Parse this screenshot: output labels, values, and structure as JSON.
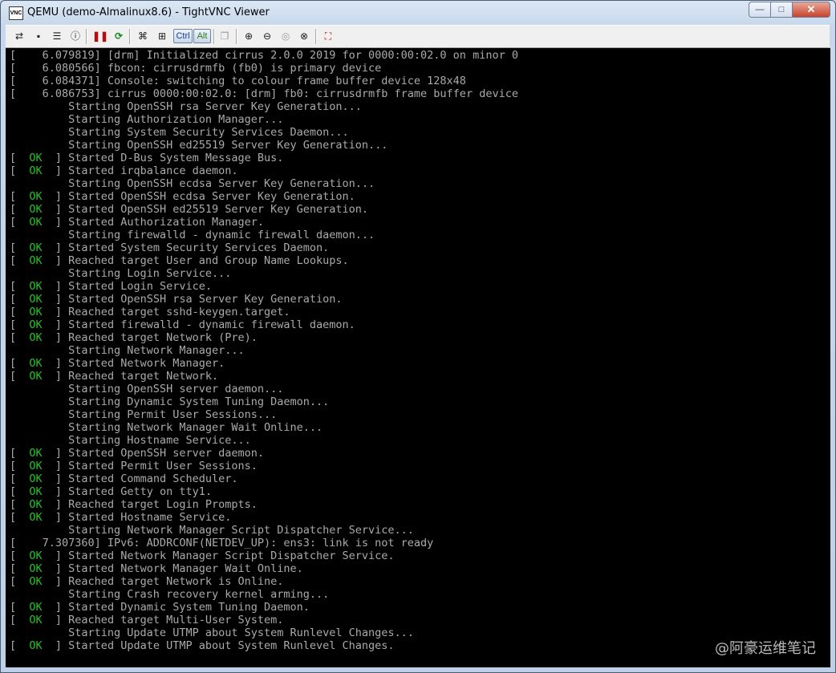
{
  "window": {
    "title": "QEMU (demo-Almalinux8.6) - TightVNC Viewer",
    "app_icon_text": "VNC",
    "controls": {
      "minimize": "—",
      "maximize": "□",
      "close": "✕"
    }
  },
  "toolbar": {
    "ctrl_label": "Ctrl",
    "alt_label": "Alt",
    "icons": [
      "new-connection-icon",
      "save-icon",
      "options-icon",
      "info-icon",
      "pause-icon",
      "refresh-icon",
      "ctrl-alt-del-icon",
      "ctrl-esc-icon",
      "ctrl-key-icon",
      "alt-key-icon",
      "clipboard-icon",
      "zoom-in-icon",
      "zoom-out-icon",
      "zoom-100-icon",
      "zoom-fit-icon",
      "fullscreen-icon"
    ]
  },
  "console": {
    "lines": [
      {
        "status": "",
        "text": "[    6.079819] [drm] Initialized cirrus 2.0.0 2019 for 0000:00:02.0 on minor 0"
      },
      {
        "status": "",
        "text": "[    6.080566] fbcon: cirrusdrmfb (fb0) is primary device"
      },
      {
        "status": "",
        "text": "[    6.084371] Console: switching to colour frame buffer device 128x48"
      },
      {
        "status": "",
        "text": "[    6.086753] cirrus 0000:00:02.0: [drm] fb0: cirrusdrmfb frame buffer device"
      },
      {
        "status": "",
        "text": "         Starting OpenSSH rsa Server Key Generation..."
      },
      {
        "status": "",
        "text": "         Starting Authorization Manager..."
      },
      {
        "status": "",
        "text": "         Starting System Security Services Daemon..."
      },
      {
        "status": "",
        "text": "         Starting OpenSSH ed25519 Server Key Generation..."
      },
      {
        "status": "OK",
        "text": "Started D-Bus System Message Bus."
      },
      {
        "status": "OK",
        "text": "Started irqbalance daemon."
      },
      {
        "status": "",
        "text": "         Starting OpenSSH ecdsa Server Key Generation..."
      },
      {
        "status": "OK",
        "text": "Started OpenSSH ecdsa Server Key Generation."
      },
      {
        "status": "OK",
        "text": "Started OpenSSH ed25519 Server Key Generation."
      },
      {
        "status": "OK",
        "text": "Started Authorization Manager."
      },
      {
        "status": "",
        "text": "         Starting firewalld - dynamic firewall daemon..."
      },
      {
        "status": "OK",
        "text": "Started System Security Services Daemon."
      },
      {
        "status": "OK",
        "text": "Reached target User and Group Name Lookups."
      },
      {
        "status": "",
        "text": "         Starting Login Service..."
      },
      {
        "status": "OK",
        "text": "Started Login Service."
      },
      {
        "status": "OK",
        "text": "Started OpenSSH rsa Server Key Generation."
      },
      {
        "status": "OK",
        "text": "Reached target sshd-keygen.target."
      },
      {
        "status": "OK",
        "text": "Started firewalld - dynamic firewall daemon."
      },
      {
        "status": "OK",
        "text": "Reached target Network (Pre)."
      },
      {
        "status": "",
        "text": "         Starting Network Manager..."
      },
      {
        "status": "OK",
        "text": "Started Network Manager."
      },
      {
        "status": "OK",
        "text": "Reached target Network."
      },
      {
        "status": "",
        "text": "         Starting OpenSSH server daemon..."
      },
      {
        "status": "",
        "text": "         Starting Dynamic System Tuning Daemon..."
      },
      {
        "status": "",
        "text": "         Starting Permit User Sessions..."
      },
      {
        "status": "",
        "text": "         Starting Network Manager Wait Online..."
      },
      {
        "status": "",
        "text": "         Starting Hostname Service..."
      },
      {
        "status": "OK",
        "text": "Started OpenSSH server daemon."
      },
      {
        "status": "OK",
        "text": "Started Permit User Sessions."
      },
      {
        "status": "OK",
        "text": "Started Command Scheduler."
      },
      {
        "status": "OK",
        "text": "Started Getty on tty1."
      },
      {
        "status": "OK",
        "text": "Reached target Login Prompts."
      },
      {
        "status": "OK",
        "text": "Started Hostname Service."
      },
      {
        "status": "",
        "text": "         Starting Network Manager Script Dispatcher Service..."
      },
      {
        "status": "",
        "text": "[    7.307360] IPv6: ADDRCONF(NETDEV_UP): ens3: link is not ready"
      },
      {
        "status": "OK",
        "text": "Started Network Manager Script Dispatcher Service."
      },
      {
        "status": "OK",
        "text": "Started Network Manager Wait Online."
      },
      {
        "status": "OK",
        "text": "Reached target Network is Online."
      },
      {
        "status": "",
        "text": "         Starting Crash recovery kernel arming..."
      },
      {
        "status": "OK",
        "text": "Started Dynamic System Tuning Daemon."
      },
      {
        "status": "OK",
        "text": "Reached target Multi-User System."
      },
      {
        "status": "",
        "text": "         Starting Update UTMP about System Runlevel Changes..."
      },
      {
        "status": "OK",
        "text": "Started Update UTMP about System Runlevel Changes."
      }
    ],
    "watermark": "@阿豪运维笔记"
  },
  "colors": {
    "console_bg": "#000000",
    "console_text": "#aaaaaa",
    "ok_green": "#22c422"
  }
}
